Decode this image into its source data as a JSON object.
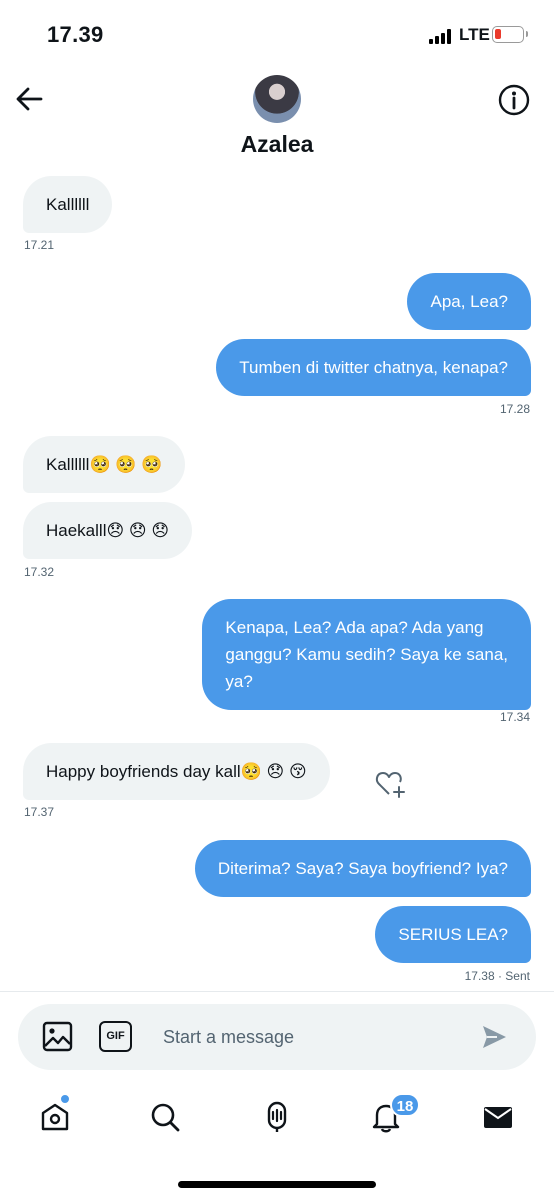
{
  "status_bar": {
    "time": "17.39",
    "network": "LTE"
  },
  "header": {
    "contact_name": "Azalea"
  },
  "messages": [
    {
      "side": "in",
      "text": "Kallllll"
    },
    {
      "side": "out",
      "text": "Apa, Lea?"
    },
    {
      "side": "out",
      "text": "Tumben di twitter chatnya, kenapa?"
    },
    {
      "side": "in",
      "text": "Kallllll🥺 🥺 🥺"
    },
    {
      "side": "in",
      "text": "Haekalll😞 😞 😞"
    },
    {
      "side": "out",
      "text": "Kenapa, Lea? Ada apa? Ada yang\nganggu? Kamu sedih? Saya ke sana,\nya?"
    },
    {
      "side": "in",
      "text": "Happy boyfriends day kall🥺 😞 😚"
    },
    {
      "side": "out",
      "text": "Diterima? Saya? Saya boyfriend? Iya?"
    },
    {
      "side": "out",
      "text": "SERIUS LEA?"
    }
  ],
  "timestamps": [
    "17.21",
    "17.28",
    "17.32",
    "17.34",
    "17.37",
    "17.38 · Sent"
  ],
  "composer": {
    "placeholder": "Start a message",
    "gif_label": "GIF"
  },
  "nav": {
    "notification_count": "18"
  },
  "colors": {
    "accent": "#4a99e9",
    "incoming_bubble": "#eff3f4",
    "outgoing_bubble": "#4a99e9",
    "battery_low": "#ea3a2c"
  }
}
